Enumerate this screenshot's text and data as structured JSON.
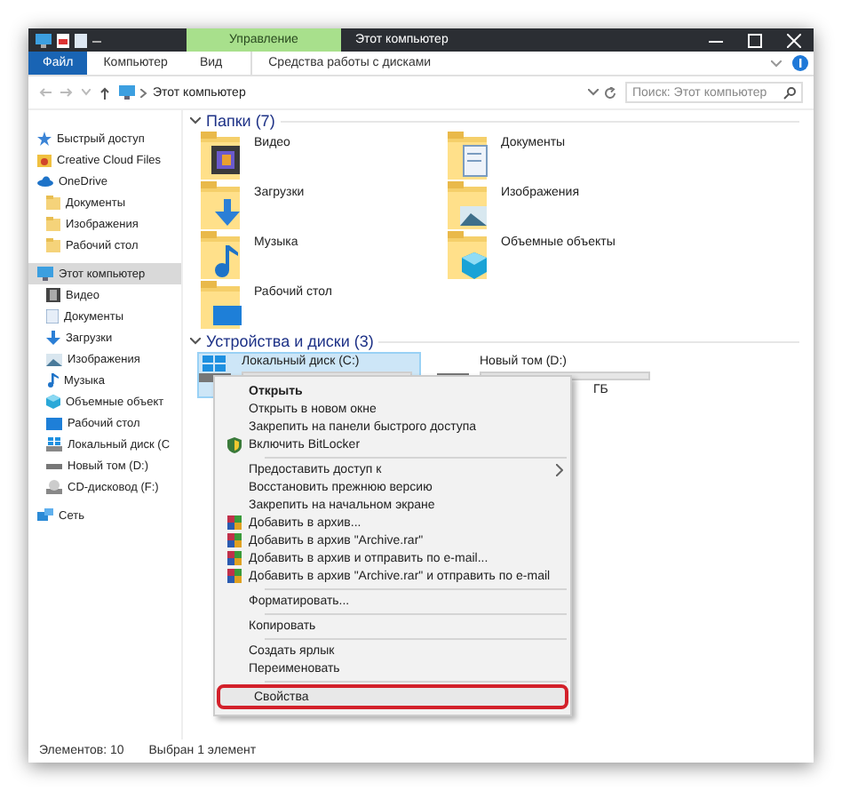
{
  "window": {
    "title": "Этот компьютер",
    "context_tab": "Управление"
  },
  "ribbon": {
    "tabs": [
      {
        "label": "Файл",
        "kind": "file"
      },
      {
        "label": "Компьютер",
        "kind": "tab"
      },
      {
        "label": "Вид",
        "kind": "tab"
      },
      {
        "label": "Средства работы с дисками",
        "kind": "context"
      }
    ]
  },
  "address": {
    "path": "Этот компьютер",
    "search_placeholder": "Поиск: Этот компьютер"
  },
  "sidebar": {
    "items": [
      {
        "label": "Быстрый доступ",
        "kind": "star",
        "selected": false
      },
      {
        "label": "Creative Cloud Files",
        "kind": "cc",
        "selected": false
      },
      {
        "label": "OneDrive",
        "kind": "cloud",
        "selected": false,
        "children": [
          {
            "label": "Документы",
            "kind": "folder",
            "selected": false
          },
          {
            "label": "Изображения",
            "kind": "folder",
            "selected": false
          },
          {
            "label": "Рабочий стол",
            "kind": "folder",
            "selected": false
          }
        ]
      },
      {
        "label": "Этот компьютер",
        "kind": "pc",
        "selected": true,
        "children": [
          {
            "label": "Видео",
            "kind": "video",
            "selected": false
          },
          {
            "label": "Документы",
            "kind": "docs",
            "selected": false
          },
          {
            "label": "Загрузки",
            "kind": "download",
            "selected": false
          },
          {
            "label": "Изображения",
            "kind": "images",
            "selected": false
          },
          {
            "label": "Музыка",
            "kind": "music",
            "selected": false
          },
          {
            "label": "Объемные объект",
            "kind": "cube",
            "selected": false
          },
          {
            "label": "Рабочий стол",
            "kind": "desktop",
            "selected": false
          },
          {
            "label": "Локальный диск (С",
            "kind": "windrive",
            "selected": false
          },
          {
            "label": "Новый том (D:)",
            "kind": "drive",
            "selected": false
          },
          {
            "label": "CD-дисковод (F:)",
            "kind": "cd",
            "selected": false
          }
        ]
      },
      {
        "label": "Сеть",
        "kind": "network",
        "selected": false
      }
    ]
  },
  "folders": {
    "title": "Папки (7)",
    "items": [
      {
        "name": "Видео",
        "kind": "video"
      },
      {
        "name": "Документы",
        "kind": "docs"
      },
      {
        "name": "Загрузки",
        "kind": "download"
      },
      {
        "name": "Изображения",
        "kind": "images"
      },
      {
        "name": "Музыка",
        "kind": "music"
      },
      {
        "name": "Объемные объекты",
        "kind": "cube"
      },
      {
        "name": "Рабочий стол",
        "kind": "desktop"
      }
    ]
  },
  "devices": {
    "title": "Устройства и диски (3)",
    "items": [
      {
        "name": "Локальный диск (C:)",
        "kind": "windrive",
        "selected": true
      },
      {
        "name": "Новый том (D:)",
        "kind": "drive",
        "selected": false,
        "free_space": "ГБ"
      }
    ]
  },
  "context_menu": {
    "items": [
      {
        "kind": "plain",
        "label": "Открыть",
        "bold": true,
        "submenu": false,
        "highlighted": false
      },
      {
        "kind": "plain",
        "label": "Открыть в новом окне",
        "bold": false,
        "submenu": false,
        "highlighted": false
      },
      {
        "kind": "plain",
        "label": "Закрепить на панели быстрого доступа",
        "bold": false,
        "submenu": false,
        "highlighted": false
      },
      {
        "kind": "shield",
        "label": "Включить BitLocker",
        "bold": false,
        "submenu": false,
        "highlighted": false
      },
      {
        "kind": "separator"
      },
      {
        "kind": "plain",
        "label": "Предоставить доступ к",
        "bold": false,
        "submenu": true,
        "highlighted": false
      },
      {
        "kind": "plain",
        "label": "Восстановить прежнюю версию",
        "bold": false,
        "submenu": false,
        "highlighted": false
      },
      {
        "kind": "plain",
        "label": "Закрепить на начальном экране",
        "bold": false,
        "submenu": false,
        "highlighted": false
      },
      {
        "kind": "archive",
        "label": "Добавить в архив...",
        "bold": false,
        "submenu": false,
        "highlighted": false
      },
      {
        "kind": "archive",
        "label": "Добавить в архив \"Archive.rar\"",
        "bold": false,
        "submenu": false,
        "highlighted": false
      },
      {
        "kind": "archive",
        "label": "Добавить в архив и отправить по e-mail...",
        "bold": false,
        "submenu": false,
        "highlighted": false
      },
      {
        "kind": "archive",
        "label": "Добавить в архив \"Archive.rar\" и отправить по e-mail",
        "bold": false,
        "submenu": false,
        "highlighted": false
      },
      {
        "kind": "separator"
      },
      {
        "kind": "plain",
        "label": "Форматировать...",
        "bold": false,
        "submenu": false,
        "highlighted": false
      },
      {
        "kind": "separator"
      },
      {
        "kind": "plain",
        "label": "Копировать",
        "bold": false,
        "submenu": false,
        "highlighted": false
      },
      {
        "kind": "separator"
      },
      {
        "kind": "plain",
        "label": "Создать ярлык",
        "bold": false,
        "submenu": false,
        "highlighted": false
      },
      {
        "kind": "plain",
        "label": "Переименовать",
        "bold": false,
        "submenu": false,
        "highlighted": false
      },
      {
        "kind": "separator"
      },
      {
        "kind": "plain",
        "label": "Свойства",
        "bold": false,
        "submenu": false,
        "highlighted": true
      }
    ]
  },
  "status_bar": {
    "items": [
      "Элементов: 10",
      "Выбран 1 элемент"
    ]
  }
}
